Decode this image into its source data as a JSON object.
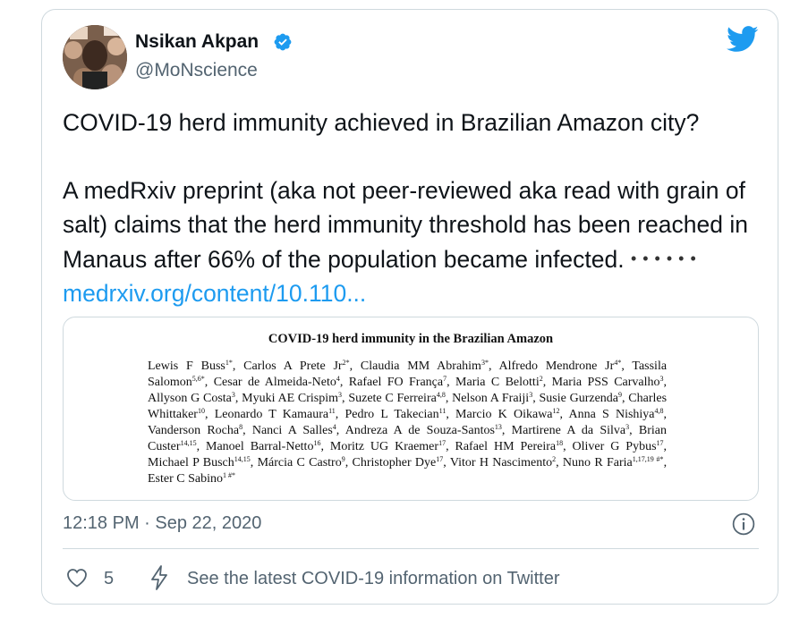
{
  "author": {
    "name": "Nsikan Akpan",
    "handle": "@MoNscience",
    "verified": true
  },
  "tweet": {
    "line1": "COVID-19 herd immunity achieved in Brazilian Amazon city?",
    "line2": "A medRxiv preprint (aka not peer-reviewed aka read with grain of salt) claims that the herd immunity threshold has been reached in Manaus after 66% of the population became infected.",
    "dots": "• • • • • •",
    "link": "medrxiv.org/content/10.110..."
  },
  "preview": {
    "title": "COVID-19 herd immunity in the Brazilian Amazon",
    "authors": [
      {
        "n": "Lewis F Buss",
        "s": "1*"
      },
      {
        "n": "Carlos A Prete Jr",
        "s": "2*"
      },
      {
        "n": "Claudia MM Abrahim",
        "s": "3*"
      },
      {
        "n": "Alfredo Mendrone Jr",
        "s": "4*"
      },
      {
        "n": "Tassila Salomon",
        "s": "5,6*"
      },
      {
        "n": "Cesar de Almeida-Neto",
        "s": "4"
      },
      {
        "n": "Rafael FO França",
        "s": "7"
      },
      {
        "n": "Maria C Belotti",
        "s": "2"
      },
      {
        "n": "Maria PSS Carvalho",
        "s": "3"
      },
      {
        "n": "Allyson G Costa",
        "s": "3"
      },
      {
        "n": "Myuki AE Crispim",
        "s": "3"
      },
      {
        "n": "Suzete C Ferreira",
        "s": "4,8"
      },
      {
        "n": "Nelson A Fraiji",
        "s": "3"
      },
      {
        "n": "Susie Gurzenda",
        "s": "9"
      },
      {
        "n": "Charles Whittaker",
        "s": "10"
      },
      {
        "n": "Leonardo T Kamaura",
        "s": "11"
      },
      {
        "n": "Pedro L Takecian",
        "s": "11"
      },
      {
        "n": "Marcio K Oikawa",
        "s": "12"
      },
      {
        "n": "Anna S Nishiya",
        "s": "4,8"
      },
      {
        "n": "Vanderson Rocha",
        "s": "8"
      },
      {
        "n": "Nanci A Salles",
        "s": "4"
      },
      {
        "n": "Andreza A de Souza-Santos",
        "s": "13"
      },
      {
        "n": "Martirene A da Silva",
        "s": "3"
      },
      {
        "n": "Brian Custer",
        "s": "14,15"
      },
      {
        "n": "Manoel Barral-Netto",
        "s": "16"
      },
      {
        "n": "Moritz UG Kraemer",
        "s": "17"
      },
      {
        "n": "Rafael HM Pereira",
        "s": "18"
      },
      {
        "n": "Oliver G Pybus",
        "s": "17"
      },
      {
        "n": "Michael P Busch",
        "s": "14,15"
      },
      {
        "n": "Márcia C Castro",
        "s": "9"
      },
      {
        "n": "Christopher Dye",
        "s": "17"
      },
      {
        "n": "Vitor H Nascimento",
        "s": "2"
      },
      {
        "n": "Nuno R Faria",
        "s": "1,17,19 #*"
      },
      {
        "n": "Ester C Sabino",
        "s": "1 #*"
      }
    ]
  },
  "meta": {
    "timestamp": "12:18 PM · Sep 22, 2020"
  },
  "actions": {
    "like_count": "5",
    "covid_info": "See the latest COVID-19 information on Twitter"
  },
  "colors": {
    "brand_blue": "#1d9bf0",
    "text_primary": "#0f1419",
    "text_secondary": "#536471",
    "border": "#cfd9de"
  }
}
